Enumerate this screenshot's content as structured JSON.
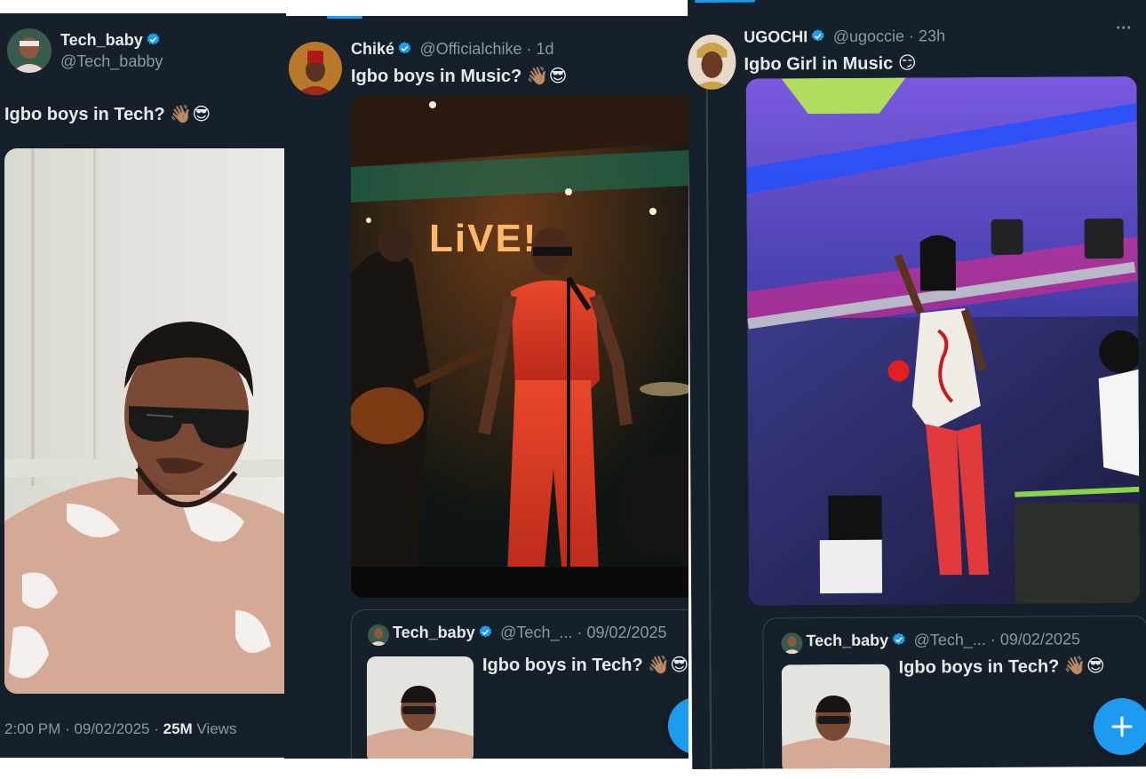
{
  "panel1": {
    "author": {
      "name": "Tech_baby",
      "handle": "@Tech_babby"
    },
    "text": "Igbo boys in Tech? 👋🏽😎",
    "footer": {
      "time_date": "2:00 PM · 09/02/2025 · ",
      "views_count": "25M",
      "views_label": " Views"
    }
  },
  "panel2": {
    "author": {
      "name": "Chiké",
      "handle": "@Officialchike · 1d"
    },
    "text": "Igbo boys in Music? 👋🏽😎",
    "photo_sign": "LiVE!",
    "quote": {
      "name": "Tech_baby",
      "handle": "@Tech_... · 09/02/2025",
      "text": "Igbo boys in Tech? 👋🏽😎"
    }
  },
  "panel3": {
    "author": {
      "name": "UGOCHI",
      "handle": "@ugoccie · 23h"
    },
    "text": "Igbo Girl in Music 😏",
    "more": "···",
    "quote": {
      "name": "Tech_baby",
      "handle": "@Tech_... · 09/02/2025",
      "text": "Igbo boys in Tech? 👋🏽😎"
    },
    "fab_icon": "plus-icon"
  },
  "colors": {
    "background": "#15202b",
    "accent": "#1d9bf0",
    "text": "#e7e9ea",
    "muted": "#8b98a5"
  }
}
